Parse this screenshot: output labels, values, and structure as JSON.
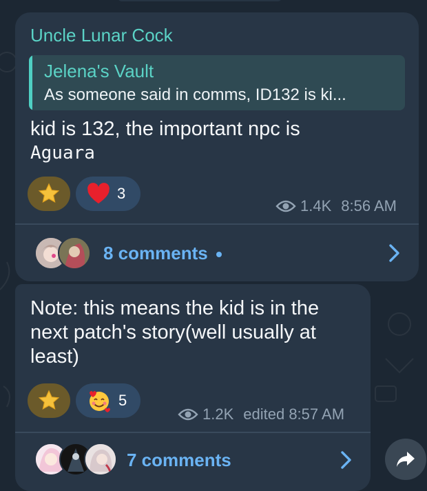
{
  "colors": {
    "background": "#1c2733",
    "bubble": "#283646",
    "sender": "#5bd3c6",
    "link": "#6ab3f3",
    "meta": "#93a3b3"
  },
  "messages": [
    {
      "sender": "Uncle Lunar Cock",
      "reply": {
        "title": "Jelena's Vault",
        "text": "As someone said in comms, ID132 is ki..."
      },
      "text_line1": "kid is 132, the important npc is",
      "text_line2": "Aguara",
      "reactions": [
        {
          "icon": "star-icon",
          "count": ""
        },
        {
          "icon": "heart-icon",
          "count": "3"
        }
      ],
      "views": "1.4K",
      "time": "8:56 AM",
      "comments": "8 comments",
      "has_unread": true
    },
    {
      "text_lines": [
        "Note: this means the kid is in the",
        "next patch's story(well usually at",
        "least)"
      ],
      "reactions": [
        {
          "icon": "star-icon",
          "count": ""
        },
        {
          "icon": "smiling-face-with-hearts-icon",
          "count": "5"
        }
      ],
      "views": "1.2K",
      "time": "edited 8:57 AM",
      "comments": "7 comments"
    }
  ]
}
